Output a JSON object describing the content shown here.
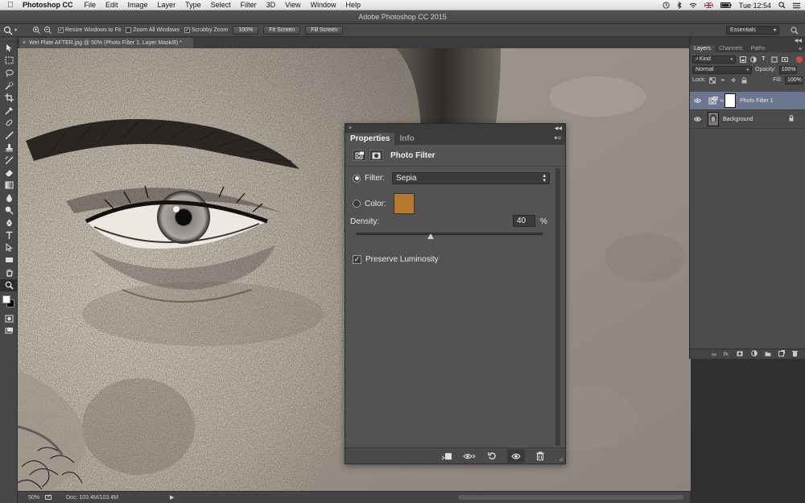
{
  "menubar": {
    "app_name": "Photoshop CC",
    "items": [
      "File",
      "Edit",
      "Image",
      "Layer",
      "Type",
      "Select",
      "Filter",
      "3D",
      "View",
      "Window",
      "Help"
    ],
    "clock": "Tue 12:54"
  },
  "window": {
    "title": "Adobe Photoshop CC 2015"
  },
  "options_bar": {
    "resize_windows": "Resize Windows to Fit",
    "zoom_all": "Zoom All Windows",
    "scrubby_zoom": "Scrubby Zoom",
    "btn_100": "100%",
    "btn_fit": "Fit Screen",
    "btn_fill": "Fill Screen",
    "workspace": "Essentials",
    "resize_checked": true,
    "zoom_all_checked": false,
    "scrubby_checked": true
  },
  "document": {
    "tab_title": "Wet Plate AFTER.jpg @ 50% (Photo Filter 1, Layer Mask/8) *"
  },
  "status_bar": {
    "zoom": "50%",
    "doc_info": "Doc: 103.4M/103.4M"
  },
  "layers_panel": {
    "tabs": [
      "Layers",
      "Channels",
      "Paths"
    ],
    "active_tab": 0,
    "kind_label": "Kind",
    "blend_mode": "Normal",
    "opacity_label": "Opacity:",
    "opacity_value": "100%",
    "lock_label": "Lock:",
    "fill_label": "Fill:",
    "fill_value": "100%",
    "layers": [
      {
        "name": "Photo Filter 1",
        "selected": true
      },
      {
        "name": "Background",
        "selected": false
      }
    ]
  },
  "properties_panel": {
    "tabs": [
      "Properties",
      "Info"
    ],
    "active_tab": 0,
    "title": "Photo Filter",
    "filter_label": "Filter:",
    "filter_value": "Sepia",
    "color_label": "Color:",
    "color_value": "#b5782e",
    "density_label": "Density:",
    "density_value": "40",
    "density_unit": "%",
    "density_fraction": 0.4,
    "preserve_luminosity_label": "Preserve Luminosity",
    "preserve_luminosity_checked": true,
    "filter_selected": true
  },
  "colors": {
    "ui_dark": "#3c3c3c",
    "ui_panel": "#535353",
    "selection_blue": "#6d7691",
    "sepia": "#b5782e"
  }
}
